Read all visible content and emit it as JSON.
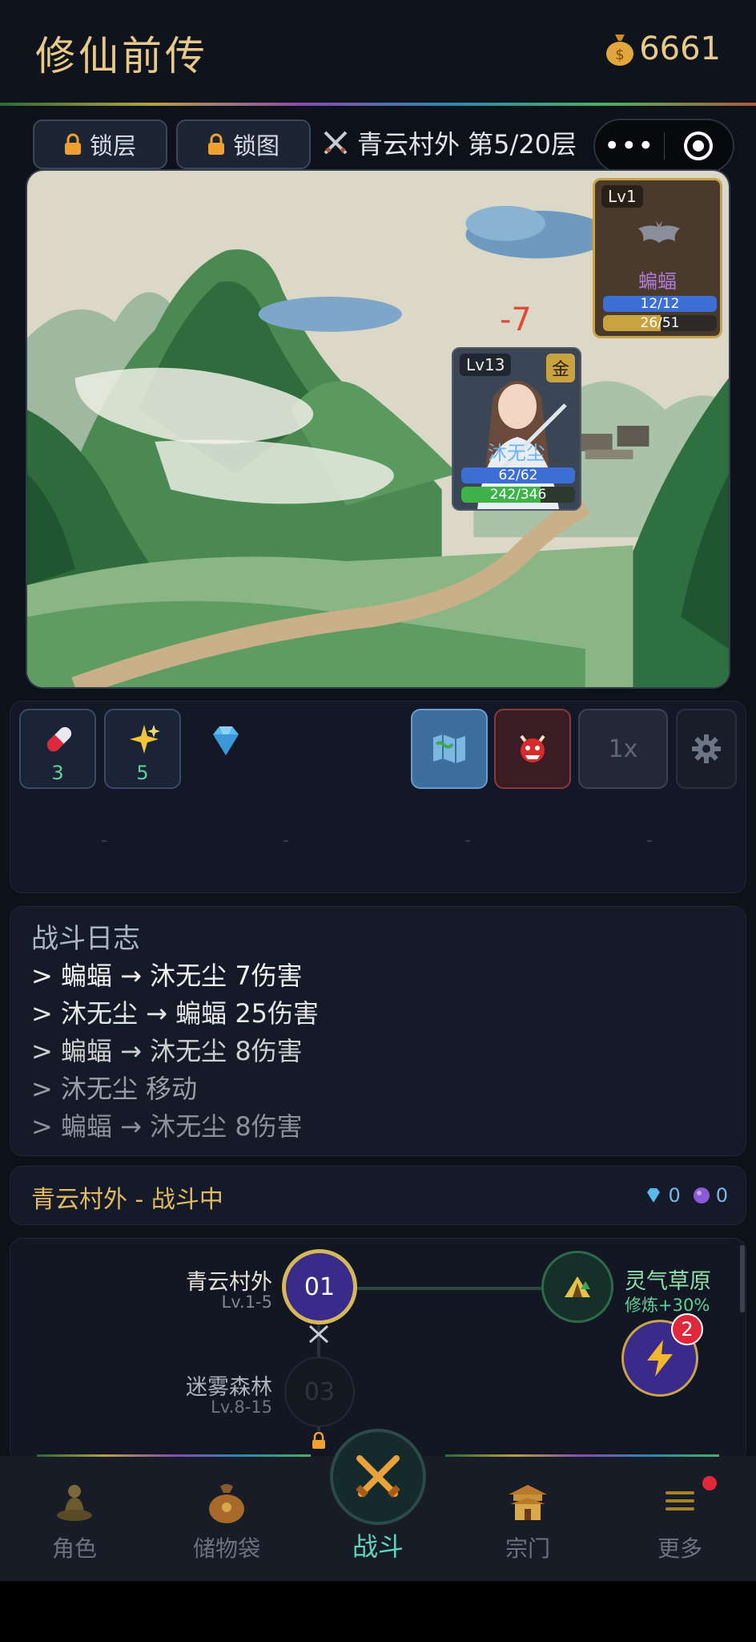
{
  "header": {
    "title": "修仙前传",
    "gold": "6661"
  },
  "toolbar": {
    "lock_floor": "锁层",
    "lock_map": "锁图",
    "stage": "青云村外 第5/20层",
    "menu_dots": "•••"
  },
  "battle": {
    "enemy": {
      "level": "Lv1",
      "name": "蝙蝠",
      "hp": "12/12",
      "exp": "26/51",
      "hp_fraction": 1.0,
      "exp_fraction": 0.51
    },
    "hero": {
      "level": "Lv13",
      "rank": "金",
      "name": "沐无尘",
      "hp": "62/62",
      "exp": "242/346",
      "hp_fraction": 1.0,
      "exp_fraction": 0.7
    },
    "damage_float": "-7"
  },
  "controls": {
    "pill_count": "3",
    "sparkle_count": "5",
    "speed": "1x",
    "dash": "-"
  },
  "log": {
    "title": "战斗日志",
    "lines": [
      "> 蝙蝠 → 沐无尘 7伤害",
      "> 沐无尘 → 蝙蝠 25伤害",
      "> 蝙蝠 → 沐无尘 8伤害",
      "> 沐无尘 移动",
      "> 蝙蝠 → 沐无尘 8伤害"
    ]
  },
  "status": {
    "text": "青云村外 - 战斗中",
    "diamonds": "0",
    "orbs": "0"
  },
  "map": {
    "node1": {
      "num": "01",
      "name": "青云村外",
      "lv": "Lv.1-5"
    },
    "node2": {
      "name": "灵气草原",
      "sub": "修炼+30%"
    },
    "node3": {
      "num": "03",
      "name": "迷雾森林",
      "lv": "Lv.8-15"
    },
    "quick_badge": "2"
  },
  "tabs": {
    "role": "角色",
    "bag": "储物袋",
    "battle": "战斗",
    "sect": "宗门",
    "more": "更多"
  },
  "colors": {
    "accent_gold": "#e8c98a",
    "battle_teal": "#5fd6c0",
    "hp_blue": "#3b6fd4",
    "exp_green": "#3fb24a"
  }
}
